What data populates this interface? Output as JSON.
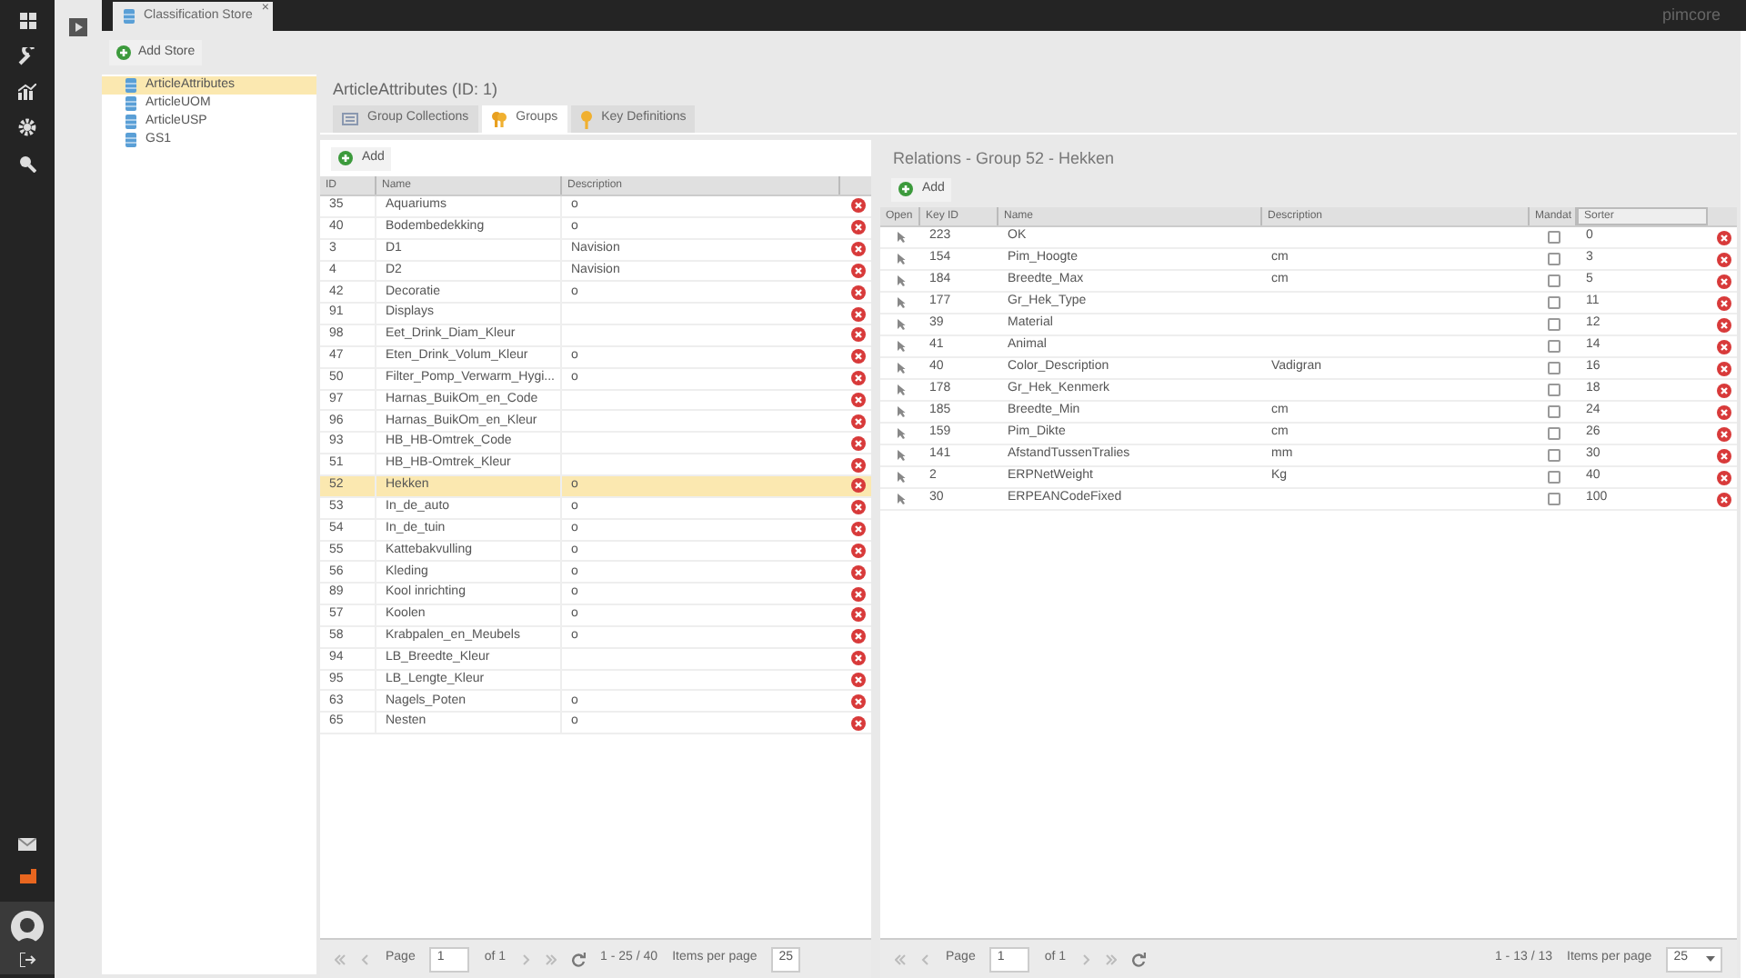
{
  "brand": "pimcore",
  "app_tab": {
    "title": "Classification Store",
    "close": "×"
  },
  "tree": {
    "add_button": "Add Store",
    "items": [
      {
        "label": "ArticleAttributes",
        "selected": true
      },
      {
        "label": "ArticleUOM",
        "selected": false
      },
      {
        "label": "ArticleUSP",
        "selected": false
      },
      {
        "label": "GS1",
        "selected": false
      }
    ]
  },
  "store": {
    "title": "ArticleAttributes (ID: 1)",
    "tabs": [
      {
        "label": "Group Collections",
        "selected": false,
        "kind": "collections"
      },
      {
        "label": "Groups",
        "selected": true,
        "kind": "groups"
      },
      {
        "label": "Key Definitions",
        "selected": false,
        "kind": "keys"
      }
    ]
  },
  "groups": {
    "add_button": "Add",
    "columns": [
      "ID",
      "Name",
      "Description"
    ],
    "rows": [
      {
        "id": "35",
        "name": "Aquariums",
        "description": "o",
        "selected": false
      },
      {
        "id": "40",
        "name": "Bodembedekking",
        "description": "o",
        "selected": false
      },
      {
        "id": "3",
        "name": "D1",
        "description": "Navision",
        "selected": false
      },
      {
        "id": "4",
        "name": "D2",
        "description": "Navision",
        "selected": false
      },
      {
        "id": "42",
        "name": "Decoratie",
        "description": "o",
        "selected": false
      },
      {
        "id": "91",
        "name": "Displays",
        "selected": false
      },
      {
        "id": "98",
        "name": "Eet_Drink_Diam_Kleur",
        "selected": false
      },
      {
        "id": "47",
        "name": "Eten_Drink_Volum_Kleur",
        "description": "o",
        "selected": false
      },
      {
        "id": "50",
        "name": "Filter_Pomp_Verwarm_Hygi...",
        "description": "o",
        "selected": false
      },
      {
        "id": "97",
        "name": "Harnas_BuikOm_en_Code",
        "selected": false
      },
      {
        "id": "96",
        "name": "Harnas_BuikOm_en_Kleur",
        "selected": false
      },
      {
        "id": "93",
        "name": "HB_HB-Omtrek_Code",
        "selected": false
      },
      {
        "id": "51",
        "name": "HB_HB-Omtrek_Kleur",
        "selected": false
      },
      {
        "id": "52",
        "name": "Hekken",
        "description": "o",
        "selected": true
      },
      {
        "id": "53",
        "name": "In_de_auto",
        "description": "o",
        "selected": false
      },
      {
        "id": "54",
        "name": "In_de_tuin",
        "description": "o",
        "selected": false
      },
      {
        "id": "55",
        "name": "Kattebakvulling",
        "description": "o",
        "selected": false
      },
      {
        "id": "56",
        "name": "Kleding",
        "description": "o",
        "selected": false
      },
      {
        "id": "89",
        "name": "Kool inrichting",
        "description": "o",
        "selected": false
      },
      {
        "id": "57",
        "name": "Koolen",
        "description": "o",
        "selected": false
      },
      {
        "id": "58",
        "name": "Krabpalen_en_Meubels",
        "description": "o",
        "selected": false
      },
      {
        "id": "94",
        "name": "LB_Breedte_Kleur",
        "selected": false
      },
      {
        "id": "95",
        "name": "LB_Lengte_Kleur",
        "selected": false
      },
      {
        "id": "63",
        "name": "Nagels_Poten",
        "description": "o",
        "selected": false
      },
      {
        "id": "65",
        "name": "Nesten",
        "description": "o",
        "selected": false
      }
    ],
    "pager": {
      "page_label": "Page",
      "page": "1",
      "of": "of 1",
      "range": "1 - 25 / 40",
      "per_page_label": "Items per page",
      "per_page": "25"
    }
  },
  "relations": {
    "title": "Relations - Group 52 - Hekken",
    "add_button": "Add",
    "columns": [
      "Open",
      "Key ID",
      "Name",
      "Description",
      "Mandat",
      "Sorter"
    ],
    "rows": [
      {
        "key_id": "223",
        "name": "OK",
        "mandatory": false,
        "sorter": "0"
      },
      {
        "key_id": "154",
        "name": "Pim_Hoogte",
        "description": "cm",
        "mandatory": false,
        "sorter": "3"
      },
      {
        "key_id": "184",
        "name": "Breedte_Max",
        "description": "cm",
        "mandatory": false,
        "sorter": "5"
      },
      {
        "key_id": "177",
        "name": "Gr_Hek_Type",
        "mandatory": false,
        "sorter": "11"
      },
      {
        "key_id": "39",
        "name": "Material",
        "mandatory": false,
        "sorter": "12"
      },
      {
        "key_id": "41",
        "name": "Animal",
        "mandatory": false,
        "sorter": "14"
      },
      {
        "key_id": "40",
        "name": "Color_Description",
        "description": "Vadigran",
        "mandatory": false,
        "sorter": "16"
      },
      {
        "key_id": "178",
        "name": "Gr_Hek_Kenmerk",
        "mandatory": false,
        "sorter": "18"
      },
      {
        "key_id": "185",
        "name": "Breedte_Min",
        "description": "cm",
        "mandatory": false,
        "sorter": "24"
      },
      {
        "key_id": "159",
        "name": "Pim_Dikte",
        "description": "cm",
        "mandatory": false,
        "sorter": "26"
      },
      {
        "key_id": "141",
        "name": "AfstandTussenTralies",
        "description": "mm",
        "mandatory": false,
        "sorter": "30"
      },
      {
        "key_id": "2",
        "name": "ERPNetWeight",
        "description": "Kg",
        "mandatory": false,
        "sorter": "40"
      },
      {
        "key_id": "30",
        "name": "ERPEANCodeFixed",
        "mandatory": false,
        "sorter": "100"
      }
    ],
    "pager": {
      "page_label": "Page",
      "page": "1",
      "of": "of 1",
      "range": "1 - 13 / 13",
      "per_page_label": "Items per page",
      "per_page": "25"
    }
  }
}
